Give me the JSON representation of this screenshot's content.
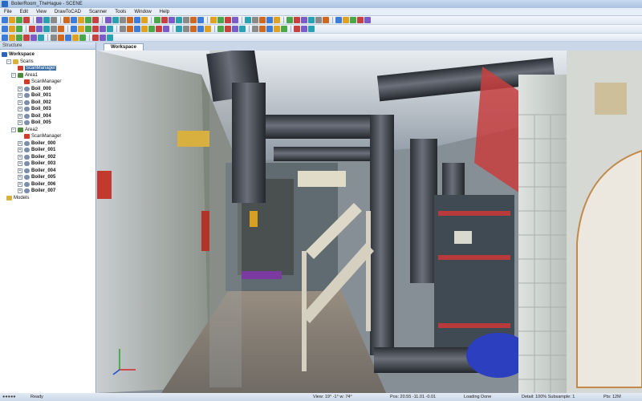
{
  "window": {
    "title": "BoilerRoom_TheHague - SCENE"
  },
  "menu": [
    "File",
    "Edit",
    "View",
    "DrawToCAD",
    "Scanner",
    "Tools",
    "Window",
    "Help"
  ],
  "panel": {
    "title": "Structure"
  },
  "tree": {
    "workspace": "Workspace",
    "scans": "Scans",
    "scan_manager_top": "ScanManager",
    "area1": "Area1",
    "area1_manager": "ScanManager",
    "area1_items": [
      "Boil_000",
      "Boil_001",
      "Boil_002",
      "Boil_003",
      "Boil_004",
      "Boil_005"
    ],
    "area2": "Area2",
    "area2_manager": "ScanManager",
    "area2_items": [
      "Boiler_000",
      "Boiler_001",
      "Boiler_002",
      "Boiler_003",
      "Boiler_004",
      "Boiler_005",
      "Boiler_006",
      "Boiler_007"
    ],
    "models": "Models"
  },
  "tab": {
    "label": "Workspace"
  },
  "status": {
    "ready": "Ready",
    "view": "View: 19° -1° w: 74°",
    "pos": "Pos: 20.55 -11.01 -0.01",
    "loading": "Loading Done",
    "detail": "Detail: 100%  Subsample: 1",
    "pts": "Pts: 12M"
  }
}
